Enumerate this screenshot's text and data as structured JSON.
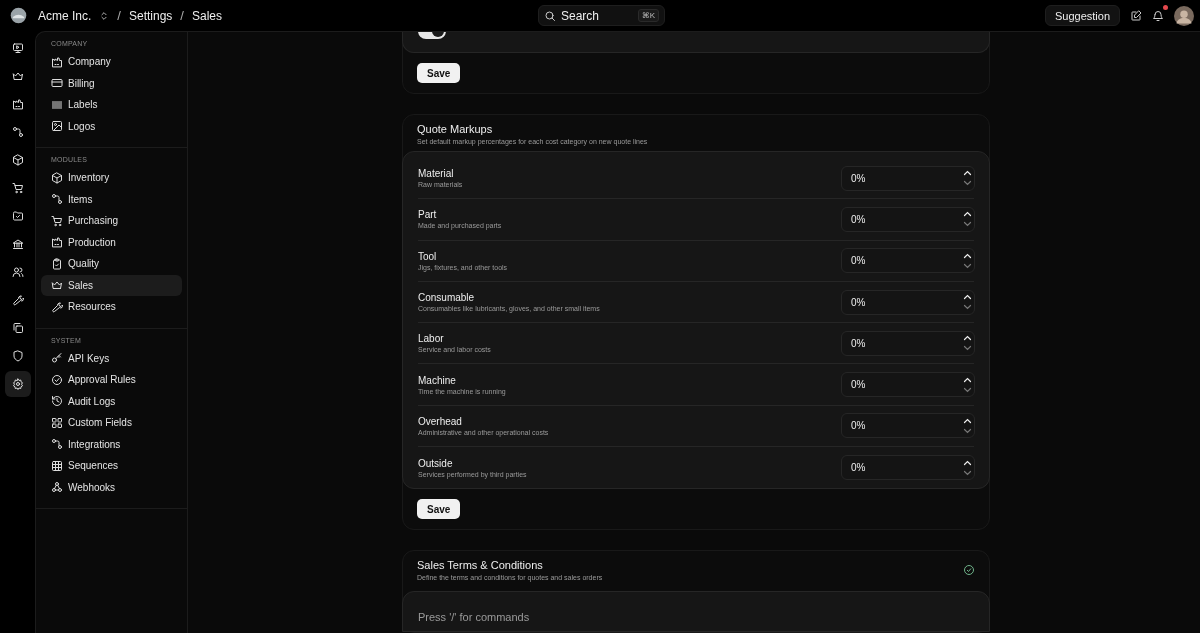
{
  "topbar": {
    "organization": "Acme Inc.",
    "breadcrumbs": [
      {
        "separator": "/",
        "label": "Settings"
      },
      {
        "separator": "/",
        "label": "Sales"
      }
    ],
    "search": {
      "label": "Search",
      "shortcut": "⌘K"
    },
    "suggestion_button": "Suggestion",
    "notifications": {
      "unread": true
    }
  },
  "rail": [
    {
      "selected": false
    },
    {
      "selected": false
    },
    {
      "selected": false
    },
    {
      "selected": false
    },
    {
      "selected": false
    },
    {
      "selected": false
    },
    {
      "selected": false
    },
    {
      "selected": false
    },
    {
      "selected": false
    },
    {
      "selected": false
    },
    {
      "selected": false
    },
    {
      "selected": false
    },
    {
      "selected": true
    }
  ],
  "settings_nav": [
    {
      "heading": "COMPANY",
      "items": [
        {
          "label": "Company",
          "selected": false
        },
        {
          "label": "Billing",
          "selected": false
        },
        {
          "label": "Labels",
          "selected": false
        },
        {
          "label": "Logos",
          "selected": false
        }
      ]
    },
    {
      "heading": "MODULES",
      "items": [
        {
          "label": "Inventory",
          "selected": false
        },
        {
          "label": "Items",
          "selected": false
        },
        {
          "label": "Purchasing",
          "selected": false
        },
        {
          "label": "Production",
          "selected": false
        },
        {
          "label": "Quality",
          "selected": false
        },
        {
          "label": "Sales",
          "selected": true
        },
        {
          "label": "Resources",
          "selected": false
        }
      ]
    },
    {
      "heading": "SYSTEM",
      "items": [
        {
          "label": "API Keys",
          "selected": false
        },
        {
          "label": "Approval Rules",
          "selected": false
        },
        {
          "label": "Audit Logs",
          "selected": false
        },
        {
          "label": "Custom Fields",
          "selected": false
        },
        {
          "label": "Integrations",
          "selected": false
        },
        {
          "label": "Sequences",
          "selected": false
        },
        {
          "label": "Webhooks",
          "selected": false
        }
      ]
    }
  ],
  "top_section": {
    "toggle": {
      "on": true
    },
    "save_button": "Save"
  },
  "quote_markups": {
    "title": "Quote Markups",
    "description": "Set default markup percentages for each cost category on new quote lines",
    "rows": [
      {
        "name": "Material",
        "description": "Raw materials",
        "value": "0%"
      },
      {
        "name": "Part",
        "description": "Made and purchased parts",
        "value": "0%"
      },
      {
        "name": "Tool",
        "description": "Jigs, fixtures, and other tools",
        "value": "0%"
      },
      {
        "name": "Consumable",
        "description": "Consumables like lubricants, gloves, and other small items",
        "value": "0%"
      },
      {
        "name": "Labor",
        "description": "Service and labor costs",
        "value": "0%"
      },
      {
        "name": "Machine",
        "description": "Time the machine is running",
        "value": "0%"
      },
      {
        "name": "Overhead",
        "description": "Administrative and other operational costs",
        "value": "0%"
      },
      {
        "name": "Outside",
        "description": "Services performed by third parties",
        "value": "0%"
      }
    ],
    "save_button": "Save"
  },
  "sales_terms": {
    "title": "Sales Terms & Conditions",
    "description": "Define the terms and conditions for quotes and sales orders",
    "complete": true,
    "editor": {
      "placeholder": "Press '/' for commands"
    }
  }
}
